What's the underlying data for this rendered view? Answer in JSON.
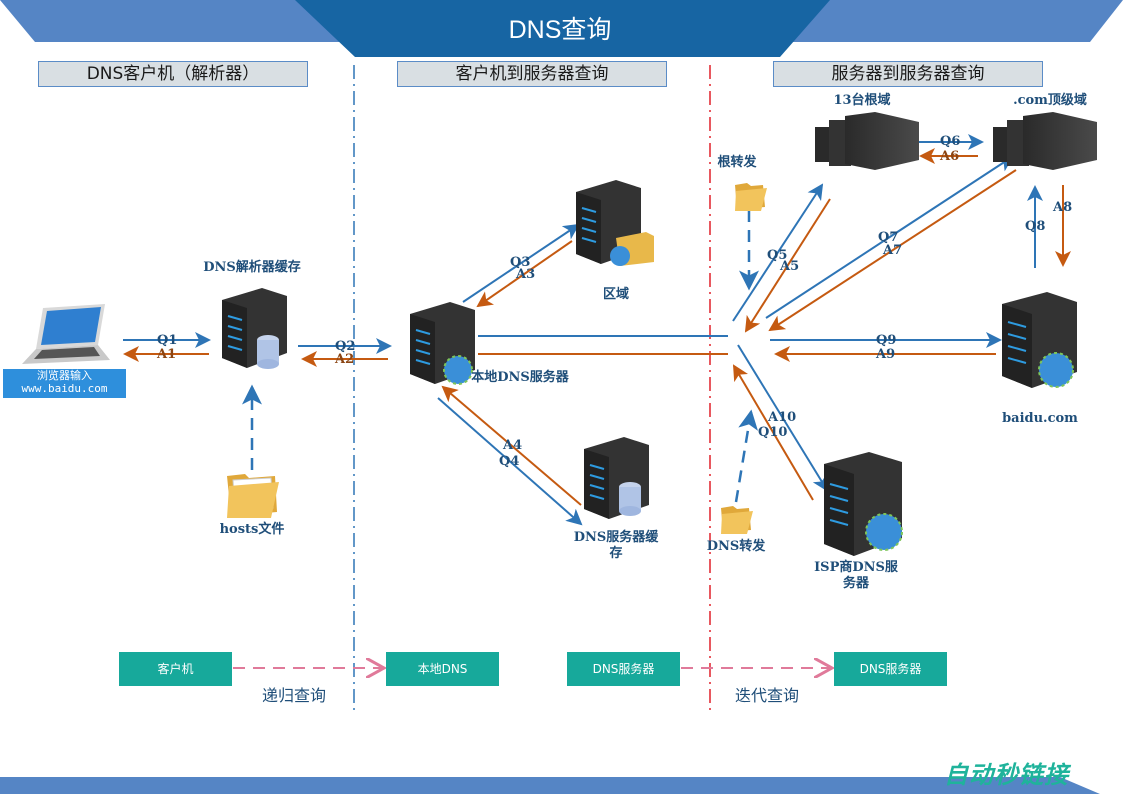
{
  "header": {
    "title": "DNS查询"
  },
  "sections": {
    "client": "DNS客户机（解析器）",
    "client_to_server": "客户机到服务器查询",
    "server_to_server": "服务器到服务器查询"
  },
  "nodes": {
    "browser": {
      "line1": "浏览器输入",
      "line2": "www.baidu.com"
    },
    "resolver_cache": "DNS解析器缓存",
    "hosts_file": "hosts文件",
    "local_dns": "本地DNS服务器",
    "zone": "区域",
    "dns_cache": "DNS服务器缓存",
    "root_forward": "根转发",
    "dns_forward": "DNS转发",
    "root_servers": "13台根域",
    "com_tld": ".com顶级域",
    "baidu": "baidu.com",
    "isp_dns": "ISP商DNS服务器"
  },
  "flows": {
    "q1": "Q1",
    "a1": "A1",
    "q2": "Q2",
    "a2": "A2",
    "q3": "Q3",
    "a3": "A3",
    "q4": "Q4",
    "a4": "A4",
    "q5": "Q5",
    "a5": "A5",
    "q6": "Q6",
    "a6": "A6",
    "q7": "Q7",
    "a7": "A7",
    "q8": "Q8",
    "a8": "A8",
    "q9": "Q9",
    "a9": "A9",
    "q10": "Q10",
    "a10": "A10"
  },
  "legend": {
    "client": "客户机",
    "local_dns": "本地DNS",
    "recursive": "递归查询",
    "dns_server_from": "DNS服务器",
    "dns_server_to": "DNS服务器",
    "iterative": "迭代查询"
  },
  "watermark": "自动秒链接",
  "colors": {
    "query": "#2e75b6",
    "answer": "#c55a11",
    "banner_dark": "#1765a3",
    "banner_light": "#5585c5",
    "teal": "#17a99b",
    "divider_blue": "#2e75b6",
    "divider_red": "#e0202a"
  }
}
